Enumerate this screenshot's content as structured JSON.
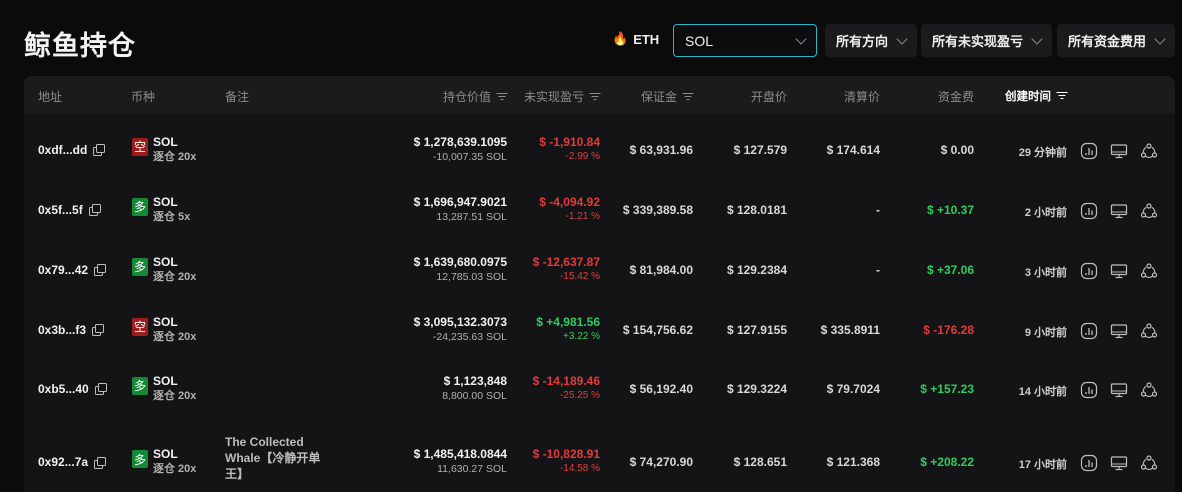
{
  "page": {
    "title": "鲸鱼持仓"
  },
  "filters": {
    "eth_label": "ETH",
    "coin_value": "SOL",
    "direction": "所有方向",
    "pnl": "所有未实现盈亏",
    "funding": "所有资金费用"
  },
  "columns": {
    "address": "地址",
    "coin": "币种",
    "note": "备注",
    "value": "持仓价值",
    "pnl": "未实现盈亏",
    "margin": "保证金",
    "open_price": "开盘价",
    "liq_price": "清算价",
    "funding": "资金费",
    "created": "创建时间"
  },
  "rows": [
    {
      "address": "0xdf...dd",
      "side": "空",
      "side_type": "short",
      "coin": "SOL",
      "leverage": "逐仓 20x",
      "note": "",
      "value": "$ 1,278,639.1095",
      "size": "-10,007.35 SOL",
      "pnl": "$ -1,910.84",
      "pnl_pct": "-2.99 %",
      "pnl_sign": "neg",
      "margin": "$ 63,931.96",
      "open_price": "$ 127.579",
      "liq_price": "$ 174.614",
      "funding": "$ 0.00",
      "funding_sign": "zero",
      "time": "29 分钟前"
    },
    {
      "address": "0x5f...5f",
      "side": "多",
      "side_type": "long",
      "coin": "SOL",
      "leverage": "逐仓 5x",
      "note": "",
      "value": "$ 1,696,947.9021",
      "size": "13,287.51 SOL",
      "pnl": "$ -4,094.92",
      "pnl_pct": "-1.21 %",
      "pnl_sign": "neg",
      "margin": "$ 339,389.58",
      "open_price": "$ 128.0181",
      "liq_price": "-",
      "funding": "$ +10.37",
      "funding_sign": "pos",
      "time": "2 小时前"
    },
    {
      "address": "0x79...42",
      "side": "多",
      "side_type": "long",
      "coin": "SOL",
      "leverage": "逐仓 20x",
      "note": "",
      "value": "$ 1,639,680.0975",
      "size": "12,785.03 SOL",
      "pnl": "$ -12,637.87",
      "pnl_pct": "-15.42 %",
      "pnl_sign": "neg",
      "margin": "$ 81,984.00",
      "open_price": "$ 129.2384",
      "liq_price": "-",
      "funding": "$ +37.06",
      "funding_sign": "pos",
      "time": "3 小时前"
    },
    {
      "address": "0x3b...f3",
      "side": "空",
      "side_type": "short",
      "coin": "SOL",
      "leverage": "逐仓 20x",
      "note": "",
      "value": "$ 3,095,132.3073",
      "size": "-24,235.63 SOL",
      "pnl": "$ +4,981.56",
      "pnl_pct": "+3.22 %",
      "pnl_sign": "pos",
      "margin": "$ 154,756.62",
      "open_price": "$ 127.9155",
      "liq_price": "$ 335.8911",
      "funding": "$ -176.28",
      "funding_sign": "neg",
      "time": "9 小时前"
    },
    {
      "address": "0xb5...40",
      "side": "多",
      "side_type": "long",
      "coin": "SOL",
      "leverage": "逐仓 20x",
      "note": "",
      "value": "$ 1,123,848",
      "size": "8,800.00 SOL",
      "pnl": "$ -14,189.46",
      "pnl_pct": "-25.25 %",
      "pnl_sign": "neg",
      "margin": "$ 56,192.40",
      "open_price": "$ 129.3224",
      "liq_price": "$ 79.7024",
      "funding": "$ +157.23",
      "funding_sign": "pos",
      "time": "14 小时前"
    },
    {
      "address": "0x92...7a",
      "side": "多",
      "side_type": "long",
      "coin": "SOL",
      "leverage": "逐仓 20x",
      "note": "The Collected Whale【冷静开单王】",
      "value": "$ 1,485,418.0844",
      "size": "11,630.27 SOL",
      "pnl": "$ -10,828.91",
      "pnl_pct": "-14.58 %",
      "pnl_sign": "neg",
      "margin": "$ 74,270.90",
      "open_price": "$ 128.651",
      "liq_price": "$ 121.368",
      "funding": "$ +208.22",
      "funding_sign": "pos",
      "time": "17 小时前"
    }
  ],
  "icons": [
    "copy-icon",
    "flame-icon",
    "chart-icon",
    "monitor-icon",
    "share-icon"
  ]
}
